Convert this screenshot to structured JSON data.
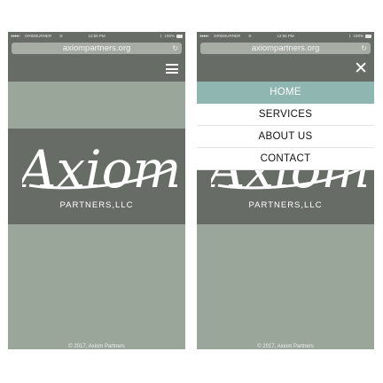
{
  "status_bar": {
    "carrier": "GRIDBURNER",
    "time": "12:55 PM",
    "battery": "100%"
  },
  "browser": {
    "url": "axiompartners.org"
  },
  "brand": {
    "logo_word": "Axiom",
    "tagline": "PARTNERS,LLC"
  },
  "menu": {
    "items": [
      "HOME",
      "SERVICES",
      "ABOUT US",
      "CONTACT"
    ],
    "active": "HOME"
  },
  "footer": {
    "copyright": "© 2017, Axiom Partners"
  },
  "colors": {
    "header": "#676c66",
    "page": "#9aa69a",
    "menu_active": "#8fb6b0",
    "menu_bg": "#ffffff"
  },
  "icons": [
    "wifi-icon",
    "bluetooth-icon",
    "battery-icon",
    "reload-icon",
    "hamburger-menu-icon",
    "close-icon"
  ]
}
